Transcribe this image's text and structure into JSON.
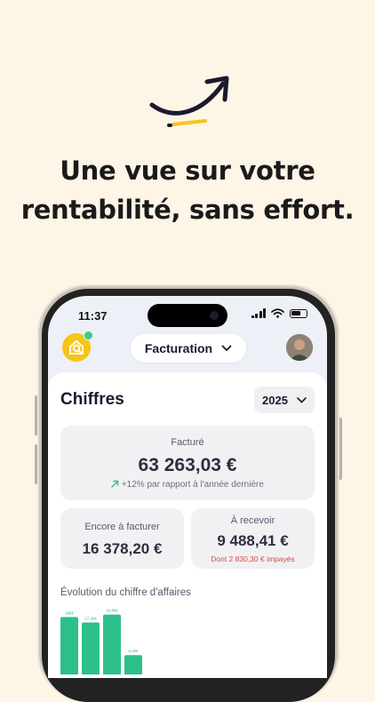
{
  "headline": {
    "line1": "Une vue sur votre",
    "line2": "rentabilité, sans effort."
  },
  "status_bar": {
    "time": "11:37"
  },
  "app_header": {
    "section_label": "Facturation"
  },
  "figures": {
    "title": "Chiffres",
    "year": "2025",
    "invoiced": {
      "label": "Facturé",
      "value": "63 263,03 €",
      "comparison": "+12% par rapport à l'année dernière"
    },
    "to_invoice": {
      "label": "Encore à facturer",
      "value": "16 378,20 €"
    },
    "to_receive": {
      "label": "À recevoir",
      "value": "9 488,41 €",
      "unpaid": "Dont 2 830,30 € impayés"
    }
  },
  "revenue_chart": {
    "title": "Évolution du chiffre d'affaires",
    "bar_labels": [
      "19k€",
      "17,2k€",
      "19,8k€",
      "6,4k€"
    ]
  },
  "chart_data": {
    "type": "bar",
    "title": "Évolution du chiffre d'affaires",
    "categories": [
      "",
      "",
      "",
      ""
    ],
    "values": [
      19,
      17.2,
      19.8,
      6.4
    ],
    "value_labels": [
      "19k€",
      "17,2k€",
      "19,8k€",
      "6,4k€"
    ],
    "ylim": [
      0,
      20
    ],
    "color": "#2dbf8a"
  },
  "colors": {
    "background": "#fdf5e6",
    "accent_yellow": "#f5c518",
    "positive_green": "#2dbf8a",
    "negative_red": "#e0453a"
  }
}
